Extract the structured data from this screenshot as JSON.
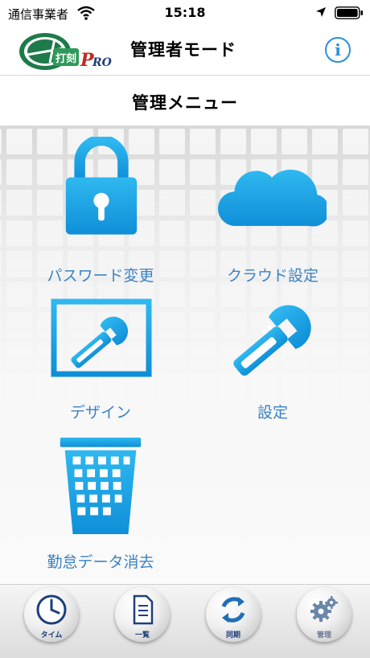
{
  "status_bar": {
    "carrier": "通信事業者",
    "time": "15:18"
  },
  "header": {
    "logo_text": "打刻PRO",
    "title": "管理者モード",
    "info_label": "i"
  },
  "menu": {
    "title": "管理メニュー",
    "items": [
      {
        "label": "パスワード変更",
        "icon": "lock-icon"
      },
      {
        "label": "クラウド設定",
        "icon": "cloud-icon"
      },
      {
        "label": "デザイン",
        "icon": "design-icon"
      },
      {
        "label": "設定",
        "icon": "wrench-icon"
      },
      {
        "label": "勤怠データ消去",
        "icon": "trash-icon"
      }
    ]
  },
  "toolbar": {
    "items": [
      {
        "label": "タイム",
        "icon": "clock-icon"
      },
      {
        "label": "一覧",
        "icon": "document-icon"
      },
      {
        "label": "同期",
        "icon": "sync-icon"
      },
      {
        "label": "管理",
        "icon": "gears-icon"
      }
    ]
  },
  "colors": {
    "accent_blue": "#1ea3e6",
    "label_blue": "#3b82c4",
    "info_blue": "#2a8ed8",
    "logo_green": "#1f7a4a"
  }
}
